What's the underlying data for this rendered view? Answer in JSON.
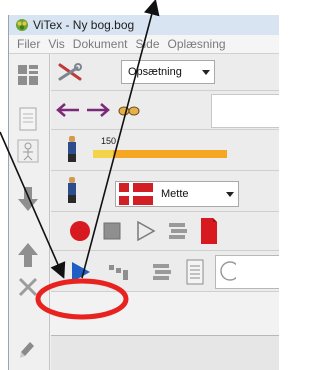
{
  "window": {
    "title": "ViTex - Ny bog.bog"
  },
  "menubar": {
    "items": [
      "Filer",
      "Vis",
      "Dokument",
      "Side",
      "Oplæsning"
    ]
  },
  "toolbar": {
    "setup_combo_value": "Opsætning",
    "speed_value": "150",
    "voice_combo_value": "Mette"
  },
  "colors": {
    "annotation_red": "#e8231f",
    "record_red": "#d71920",
    "play_blue": "#1f5fc4",
    "speed_orange": "#f5a623",
    "flag_red": "#d21f26"
  },
  "icons": {
    "sidebar": [
      "grid-icon",
      "page-icon",
      "person-icon",
      "arrow-down-icon",
      "arrow-up-icon",
      "close-x-icon",
      "pencil-icon"
    ],
    "row1": [
      "wrench-icon",
      "dropdown-combo"
    ],
    "row2": [
      "arrow-left-icon",
      "arrow-right-icon",
      "glasses-icon"
    ],
    "row3": [
      "person-icon",
      "speed-bar"
    ],
    "row4": [
      "person-icon",
      "danish-flag-icon",
      "dropdown-combo"
    ],
    "row5": [
      "record-icon",
      "stop-icon",
      "play-outline-icon",
      "lines-icon",
      "red-document-icon"
    ],
    "row6": [
      "play-icon",
      "steps-icon",
      "lines-icon",
      "document-icon",
      "circle-icon"
    ]
  }
}
